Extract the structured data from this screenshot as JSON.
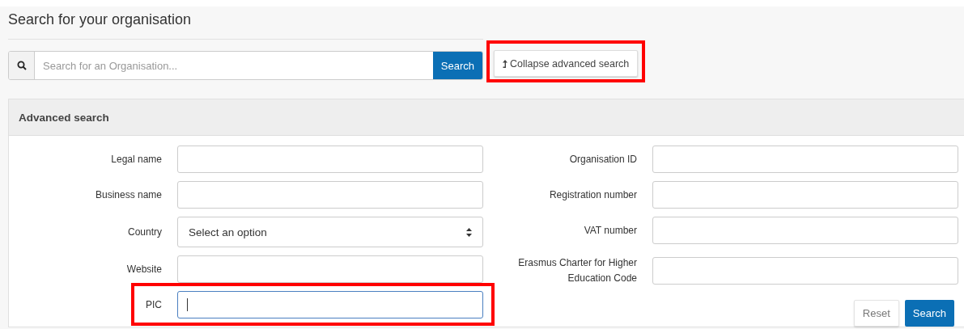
{
  "title": "Search for your organisation",
  "quick_search": {
    "placeholder": "Search for an Organisation...",
    "button": "Search"
  },
  "toggle_button": {
    "label": "Collapse advanced search",
    "highlighted": true
  },
  "advanced_search": {
    "title": "Advanced search",
    "left_fields": [
      {
        "label": "Legal name",
        "kind": "text",
        "focused": false,
        "highlighted": false
      },
      {
        "label": "Business name",
        "kind": "text",
        "focused": false,
        "highlighted": false
      },
      {
        "label": "Country",
        "kind": "select",
        "value": "Select an option",
        "focused": false,
        "highlighted": false
      },
      {
        "label": "Website",
        "kind": "text",
        "focused": false,
        "highlighted": false
      },
      {
        "label": "PIC",
        "kind": "text",
        "focused": true,
        "highlighted": true
      }
    ],
    "right_fields": [
      {
        "label": "Organisation ID",
        "kind": "text",
        "focused": false,
        "highlighted": false
      },
      {
        "label": "Registration number",
        "kind": "text",
        "focused": false,
        "highlighted": false
      },
      {
        "label": "VAT number",
        "kind": "text",
        "focused": false,
        "highlighted": false
      },
      {
        "label": "Erasmus Charter for Higher Education Code",
        "kind": "text",
        "focused": false,
        "highlighted": false
      }
    ],
    "buttons": [
      {
        "label": "Reset",
        "kind": "secondary"
      },
      {
        "label": "Search",
        "kind": "primary"
      }
    ]
  }
}
